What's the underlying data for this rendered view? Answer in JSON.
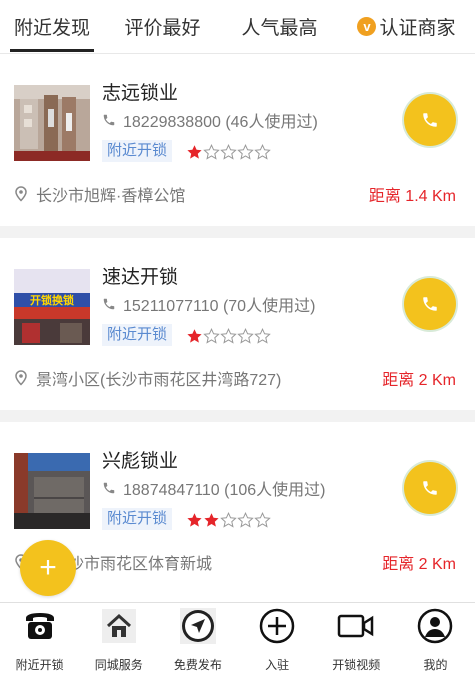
{
  "tabs": [
    {
      "label": "附近发现",
      "active": true
    },
    {
      "label": "评价最好",
      "active": false
    },
    {
      "label": "人气最高",
      "active": false
    },
    {
      "label": "认证商家",
      "active": false,
      "icon": "verified-v-icon"
    }
  ],
  "shops": [
    {
      "name": "志远锁业",
      "phone_text": "18229838800 (46人使用过)",
      "tag": "附近开锁",
      "rating": 1,
      "max_rating": 5,
      "address": "长沙市旭辉·香樟公馆",
      "distance": "距离 1.4 Km"
    },
    {
      "name": "速达开锁",
      "phone_text": "15211077110 (70人使用过)",
      "tag": "附近开锁",
      "rating": 1,
      "max_rating": 5,
      "address": "景湾小区(长沙市雨花区井湾路727)",
      "distance": "距离 2 Km",
      "thumb_sign": "开锁换锁"
    },
    {
      "name": "兴彪锁业",
      "phone_text": "18874847110 (106人使用过)",
      "tag": "附近开锁",
      "rating": 2,
      "max_rating": 5,
      "address": "省长沙市雨花区体育新城",
      "distance": "距离 2 Km"
    }
  ],
  "fab": {
    "label": "+"
  },
  "bottom_nav": [
    {
      "label": "附近开锁",
      "icon": "telephone-icon"
    },
    {
      "label": "同城服务",
      "icon": "home-icon"
    },
    {
      "label": "免费发布",
      "icon": "navigation-arrow-icon"
    },
    {
      "label": "入驻",
      "icon": "plus-circle-icon"
    },
    {
      "label": "开锁视频",
      "icon": "video-camera-icon"
    },
    {
      "label": "我的",
      "icon": "user-icon"
    }
  ],
  "colors": {
    "accent_yellow": "#f3c21d",
    "distance_red": "#e5252a",
    "star_red": "#e5252a",
    "tag_blue": "#5a8ad0",
    "tag_bg": "#eef3fb"
  }
}
